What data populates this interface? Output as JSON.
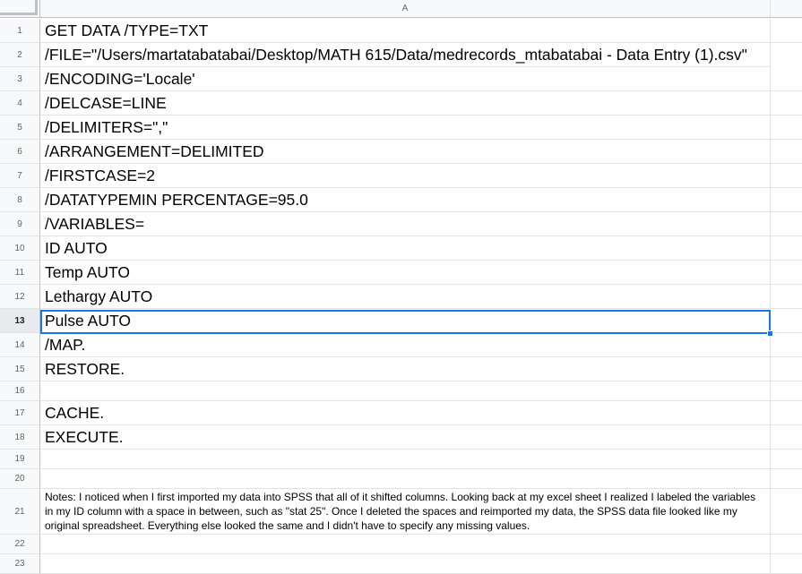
{
  "sheet": {
    "column_header": "A",
    "selected_row": "13",
    "rows": [
      {
        "num": "1",
        "text": "GET DATA /TYPE=TXT"
      },
      {
        "num": "2",
        "text": "/FILE=\"/Users/martatabatabai/Desktop/MATH 615/Data/medrecords_mtabatabai - Data Entry (1).csv\""
      },
      {
        "num": "3",
        "text": "/ENCODING='Locale'"
      },
      {
        "num": "4",
        "text": "/DELCASE=LINE"
      },
      {
        "num": "5",
        "text": "/DELIMITERS=\",\""
      },
      {
        "num": "6",
        "text": "/ARRANGEMENT=DELIMITED"
      },
      {
        "num": "7",
        "text": "/FIRSTCASE=2"
      },
      {
        "num": "8",
        "text": "/DATATYPEMIN PERCENTAGE=95.0"
      },
      {
        "num": "9",
        "text": "/VARIABLES="
      },
      {
        "num": "10",
        "text": "ID AUTO"
      },
      {
        "num": "11",
        "text": "Temp AUTO"
      },
      {
        "num": "12",
        "text": "Lethargy AUTO"
      },
      {
        "num": "13",
        "text": "Pulse AUTO"
      },
      {
        "num": "14",
        "text": "/MAP."
      },
      {
        "num": "15",
        "text": "RESTORE."
      },
      {
        "num": "16",
        "text": ""
      },
      {
        "num": "17",
        "text": "CACHE."
      },
      {
        "num": "18",
        "text": "EXECUTE."
      },
      {
        "num": "19",
        "text": ""
      },
      {
        "num": "20",
        "text": ""
      },
      {
        "num": "21",
        "text": "Notes: I noticed when I first imported my data into SPSS that all of it shifted columns. Looking back at my excel sheet I realized I labeled the variables in my ID column with a space in between, such as \"stat 25\". Once I deleted the spaces and reimported my data, the SPSS data file looked like my original spreadsheet. Everything else looked the same and I didn't have to specify any missing values."
      },
      {
        "num": "22",
        "text": ""
      },
      {
        "num": "23",
        "text": ""
      }
    ]
  }
}
